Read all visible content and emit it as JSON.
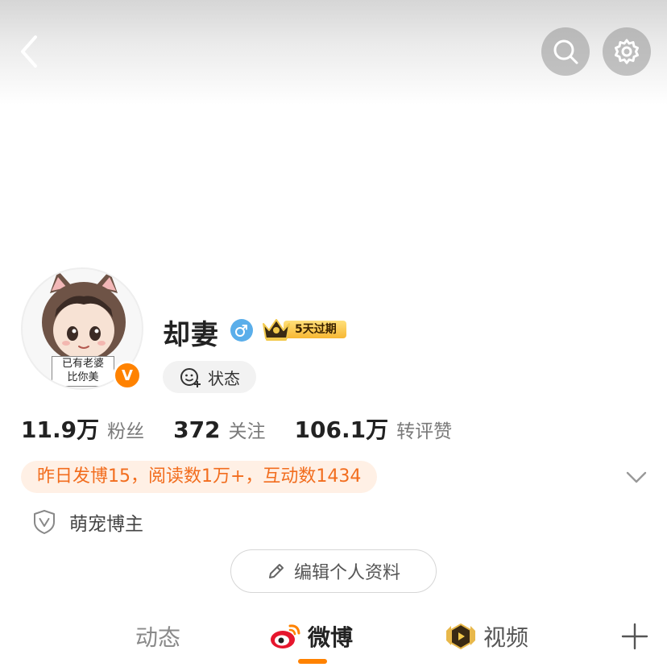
{
  "header": {
    "back_icon": "chevron-left-icon",
    "search_icon": "search-icon",
    "settings_icon": "gear-icon"
  },
  "profile": {
    "avatar_caption_line1": "已有老婆",
    "avatar_caption_line2": "比你美",
    "verified_mark": "V",
    "username": "却妻",
    "gender_icon": "male-icon",
    "vip_label": "5天过期",
    "status_label": "状态"
  },
  "stats": [
    {
      "value": "11.9万",
      "label": "粉丝"
    },
    {
      "value": "372",
      "label": "关注"
    },
    {
      "value": "106.1万",
      "label": "转评赞"
    }
  ],
  "activity": {
    "text": "昨日发博15，阅读数1万+，互动数1434"
  },
  "tag": {
    "label": "萌宠博主"
  },
  "edit_profile": {
    "label": "编辑个人资料"
  },
  "tabs": [
    {
      "label": "动态"
    },
    {
      "label": "微博",
      "selected": true
    },
    {
      "label": "视频"
    }
  ],
  "colors": {
    "accent": "#ff8200",
    "activity_bg": "#fff0e5",
    "activity_text": "#f26d1e",
    "gender": "#5aaeea"
  }
}
